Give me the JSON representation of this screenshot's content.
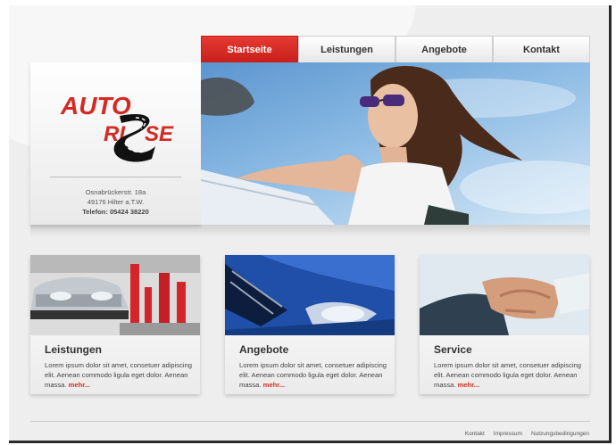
{
  "nav": {
    "items": [
      {
        "label": "Startseite",
        "active": true
      },
      {
        "label": "Leistungen",
        "active": false
      },
      {
        "label": "Angebote",
        "active": false
      },
      {
        "label": "Kontakt",
        "active": false
      }
    ]
  },
  "logo": {
    "line1": "AUTO",
    "line2": "RI",
    "line3": "SE",
    "icon": "road-swirl-icon"
  },
  "address": {
    "street": "Osnabrückerstr. 18a",
    "city": "49176 Hilter a.T.W.",
    "phone": "Telefon: 05424 38220"
  },
  "cards": [
    {
      "title": "Leistungen",
      "text": "Lorem ipsum dolor sit amet, consetuer adipiscing elit. Aenean commodo ligula eget dolor. Aenean massa.",
      "more": "mehr..."
    },
    {
      "title": "Angebote",
      "text": "Lorem ipsum dolor sit amet, consetuer adipiscing elit. Aenean commodo ligula eget dolor. Aenean massa.",
      "more": "mehr..."
    },
    {
      "title": "Service",
      "text": "Lorem ipsum dolor sit amet, consetuer adipiscing elit. Aenean commodo ligula eget dolor. Aenean massa.",
      "more": "mehr..."
    }
  ],
  "footer": {
    "links": [
      "Kontakt",
      "Impressum",
      "Nutzungsbedingungen"
    ]
  },
  "colors": {
    "accent": "#d42a23",
    "background": "#eeeeee"
  }
}
